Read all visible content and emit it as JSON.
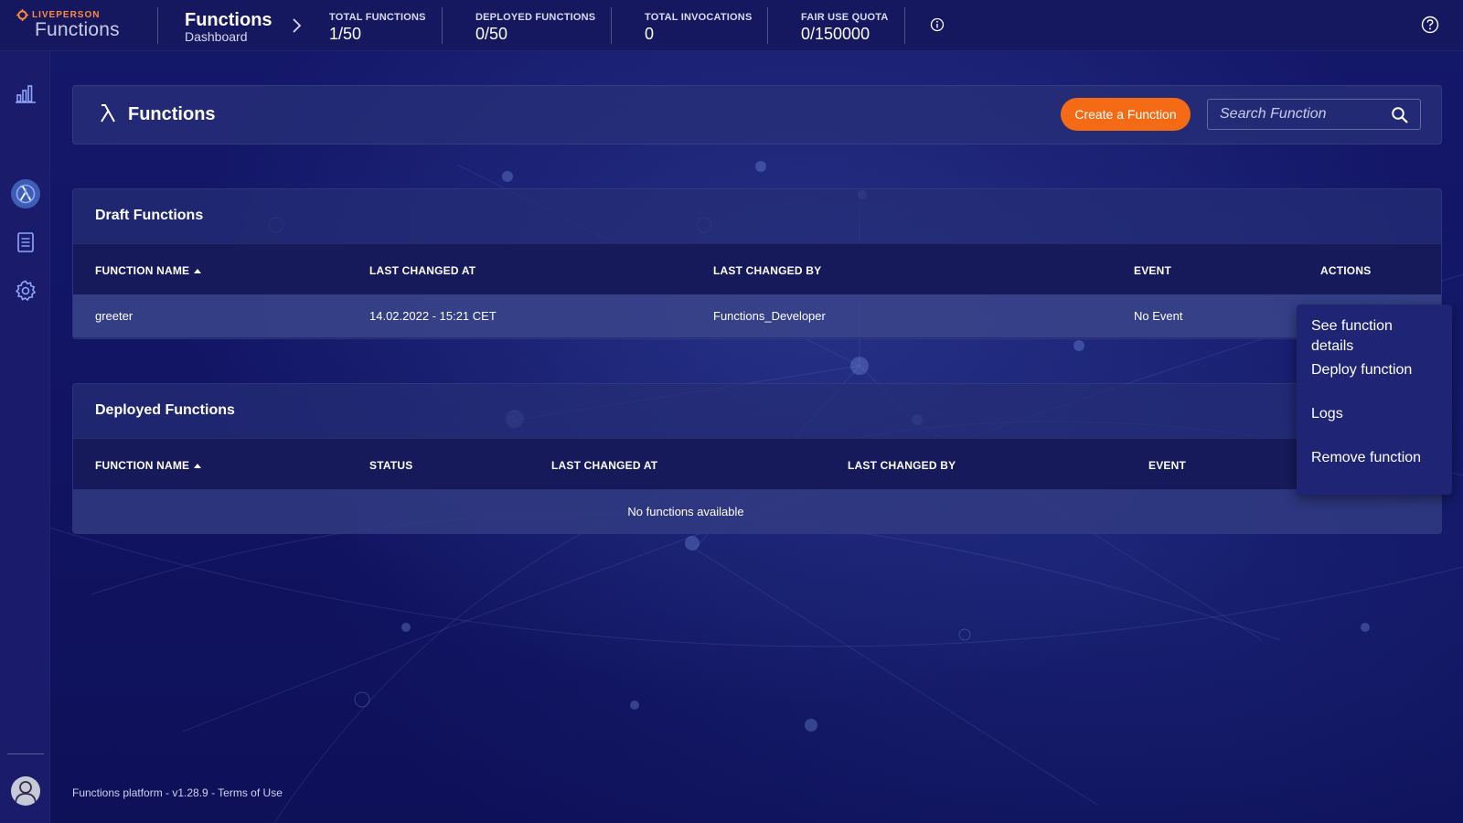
{
  "app": {
    "brand": "LIVEPERSON",
    "product": "Functions"
  },
  "breadcrumb": {
    "title": "Functions",
    "subtitle": "Dashboard"
  },
  "stats": [
    {
      "label": "TOTAL FUNCTIONS",
      "value": "1/50"
    },
    {
      "label": "DEPLOYED FUNCTIONS",
      "value": "0/50"
    },
    {
      "label": "TOTAL INVOCATIONS",
      "value": "0"
    },
    {
      "label": "FAIR USE QUOTA",
      "value": "0/150000"
    }
  ],
  "sidebar": {
    "items": [
      {
        "icon": "bar-chart-icon"
      },
      {
        "icon": "lambda-icon",
        "active": true
      },
      {
        "icon": "clock-icon"
      },
      {
        "icon": "document-icon"
      },
      {
        "icon": "gear-icon"
      }
    ],
    "bottom": [
      {
        "icon": "help-icon"
      },
      {
        "icon": "user-avatar-icon"
      }
    ]
  },
  "header": {
    "title": "Functions",
    "create_label": "Create a Function",
    "search_placeholder": "Search Function"
  },
  "draft": {
    "title": "Draft Functions",
    "columns": [
      "FUNCTION NAME",
      "LAST CHANGED AT",
      "LAST CHANGED BY",
      "EVENT",
      "ACTIONS"
    ],
    "rows": [
      {
        "name": "greeter",
        "changed_at": "14.02.2022 - 15:21 CET",
        "changed_by": "Functions_Developer",
        "event": "No Event"
      }
    ]
  },
  "deployed": {
    "title": "Deployed Functions",
    "columns": [
      "FUNCTION NAME",
      "STATUS",
      "LAST CHANGED AT",
      "LAST CHANGED BY",
      "EVENT"
    ],
    "empty_text": "No functions available"
  },
  "context_menu": {
    "items": [
      "See function details",
      "Deploy function",
      "Logs",
      "Remove function"
    ]
  },
  "footer": {
    "text": "Functions platform - v1.28.9 - Terms of Use"
  },
  "colors": {
    "accent": "#f56a14",
    "background": "#121565",
    "panel": "#262e76",
    "active_nav": "#3d5db3"
  }
}
